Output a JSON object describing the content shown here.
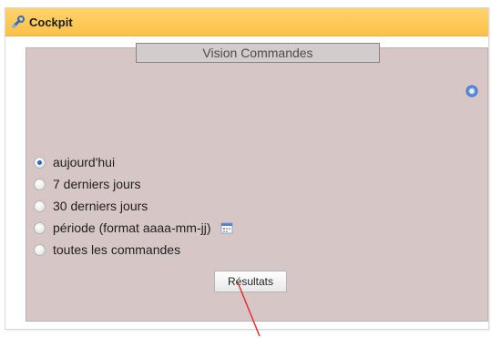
{
  "panel": {
    "title": "Cockpit"
  },
  "section": {
    "title": "Vision Commandes"
  },
  "options": [
    {
      "label": "aujourd'hui",
      "checked": true
    },
    {
      "label": "7 derniers jours",
      "checked": false
    },
    {
      "label": "30 derniers jours",
      "checked": false
    },
    {
      "label": "période (format aaaa-mm-jj)",
      "checked": false
    },
    {
      "label": "toutes les commandes",
      "checked": false
    }
  ],
  "buttons": {
    "results_label": "Résultats"
  },
  "colors": {
    "header_bg": "#fbc14a",
    "content_bg": "#d6c7c6",
    "annotation_line": "#e53030"
  }
}
